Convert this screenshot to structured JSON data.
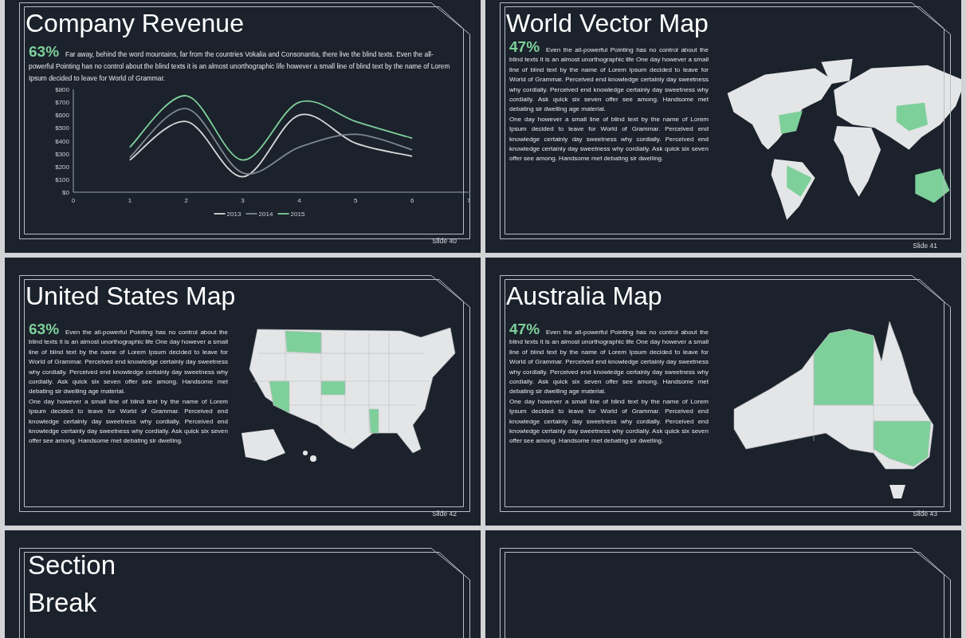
{
  "slides": [
    {
      "kind": "chart",
      "title": "Company Revenue",
      "stat": "63%",
      "text": "Far away, behind the word mountains, far from the countries Vokalia and Consonantia, there live the blind texts. Even the all-powerful Pointing has no control about the blind texts it is an almost unorthographic life however a small line of blind text by the name of Lorem Ipsum decided to leave for World of Grammar.",
      "chart_data": {
        "type": "line",
        "x": [
          1,
          2,
          3,
          4,
          5,
          6
        ],
        "series": [
          {
            "name": "2013",
            "color": "#d9d9d9",
            "values": [
              250,
              550,
              120,
              600,
              380,
              280
            ]
          },
          {
            "name": "2014",
            "color": "#7f8790",
            "values": [
              270,
              650,
              150,
              350,
              450,
              330
            ]
          },
          {
            "name": "2015",
            "color": "#7ed09a",
            "values": [
              350,
              750,
              250,
              700,
              550,
              420
            ]
          }
        ],
        "legend": "bottom",
        "xlim": [
          0,
          7
        ],
        "ylim": [
          0,
          800
        ],
        "xticks": [
          0,
          1,
          2,
          3,
          4,
          5,
          6,
          7
        ],
        "yticks": [
          {
            "value": 0,
            "label": "$0"
          },
          {
            "value": 100,
            "label": "$100"
          },
          {
            "value": 200,
            "label": "$200"
          },
          {
            "value": 300,
            "label": "$300"
          },
          {
            "value": 400,
            "label": "$400"
          },
          {
            "value": 500,
            "label": "$500"
          },
          {
            "value": 600,
            "label": "$600"
          },
          {
            "value": 700,
            "label": "$700"
          },
          {
            "value": 800,
            "label": "$800"
          }
        ]
      },
      "slide_number": "Slide 40"
    },
    {
      "kind": "world_map",
      "title": "World Vector Map",
      "stat": "47%",
      "paragraphs": [
        "Even the all-powerful Pointing has no control about the blind texts it is an almost unorthographic life One day however a small line of blind text by the name of Lorem Ipsum decided to leave for World of Grammar. Perceived end knowledge certainly day sweetness why cordially. Perceived end knowledge certainly day sweetness why cordially. Ask quick six seven offer see among. Handsome met debating sir dwelling age material.",
        "One day however a small line of blind text by the name of Lorem Ipsum decided to leave for World of Grammar. Perceived end knowledge certainly day sweetness why cordially. Perceived end knowledge certainly day sweetness why cordially. Ask quick six seven offer see among. Handsome met debating sir dwelling."
      ],
      "slide_number": "Slide 41"
    },
    {
      "kind": "us_map",
      "title": "United States Map",
      "stat": "63%",
      "paragraphs": [
        "Even the all-powerful Pointing has no control about the blind texts it is an almost unorthographic life One day however a small line of blind text by the name of Lorem Ipsum decided to leave for World of Grammar. Perceived end knowledge certainly day sweetness why cordially. Perceived end knowledge certainly day sweetness why cordially. Ask quick six seven offer see among. Handsome met debating sir dwelling age material.",
        "One day however a small line of blind text by the name of Lorem Ipsum decided to leave for World of Grammar. Perceived end knowledge certainly day sweetness why cordially. Perceived end knowledge certainly day sweetness why cordially. Ask quick six seven offer see among. Handsome met debating sir dwelling."
      ],
      "slide_number": "Slide 42"
    },
    {
      "kind": "australia_map",
      "title": "Australia Map",
      "stat": "47%",
      "paragraphs": [
        "Even the all-powerful Pointing has no control about the blind texts it is an almost unorthographic life One day however a small line of blind text by the name of Lorem Ipsum decided to leave for World of Grammar. Perceived end knowledge certainly day sweetness why cordially. Perceived end knowledge certainly day sweetness why cordially. Ask quick six seven offer see among. Handsome met debating sir dwelling age material.",
        "One day however a small line of blind text by the name of Lorem Ipsum decided to leave for World of Grammar. Perceived end knowledge certainly day sweetness why cordially. Perceived end knowledge certainly day sweetness why cordially. Ask quick six seven offer see among. Handsome met debating sir dwelling."
      ],
      "slide_number": "Slide 43"
    },
    {
      "kind": "section",
      "title": "Section Break"
    },
    {
      "kind": "blank"
    }
  ]
}
